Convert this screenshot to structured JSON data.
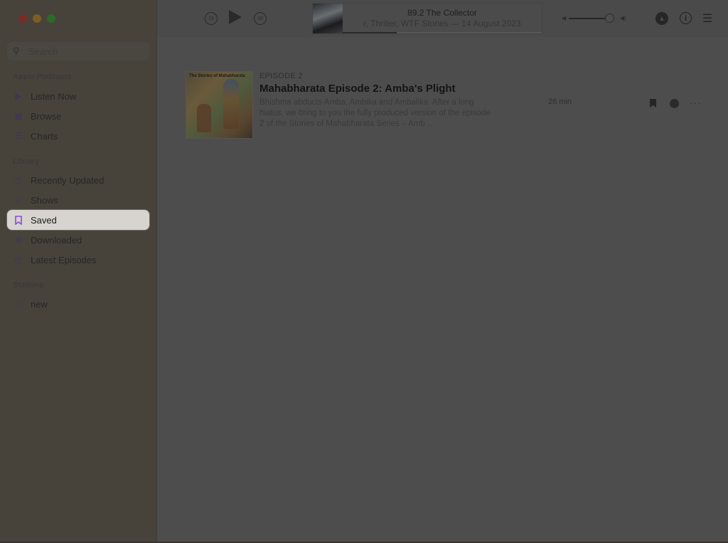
{
  "window": {
    "traffic_lights": [
      "close",
      "minimize",
      "zoom"
    ]
  },
  "sidebar": {
    "search": {
      "placeholder": "Search",
      "value": ""
    },
    "sections": [
      {
        "header": "Apple Podcasts",
        "items": [
          {
            "label": "Listen Now",
            "icon": "play-circle-icon",
            "selected": false
          },
          {
            "label": "Browse",
            "icon": "grid-icon",
            "selected": false
          },
          {
            "label": "Charts",
            "icon": "list-icon",
            "selected": false
          }
        ]
      },
      {
        "header": "Library",
        "items": [
          {
            "label": "Recently Updated",
            "icon": "clock-icon",
            "selected": false
          },
          {
            "label": "Shows",
            "icon": "shows-icon",
            "selected": false
          },
          {
            "label": "Saved",
            "icon": "bookmark-icon",
            "selected": true
          },
          {
            "label": "Downloaded",
            "icon": "download-icon",
            "selected": false
          },
          {
            "label": "Latest Episodes",
            "icon": "latest-icon",
            "selected": false
          }
        ]
      },
      {
        "header": "Stations",
        "items": [
          {
            "label": "new",
            "icon": "station-icon",
            "selected": false
          }
        ]
      }
    ]
  },
  "player": {
    "skip_back_label": "15",
    "skip_forward_label": "30",
    "now_playing_title": "89.2 The Collector",
    "now_playing_subtitle": "r, Thriller, WTF Stories — 14 August 2023",
    "progress_fraction": 0.27,
    "volume_fraction": 0.9,
    "icons": {
      "skip_back": "gobackward-15-icon",
      "play": "play-icon",
      "skip_forward": "goforward-30-icon",
      "airplay": "airplay-icon",
      "info": "info-icon",
      "queue": "queue-list-icon"
    }
  },
  "episodes": [
    {
      "label": "EPISODE 2",
      "title": "Mahabharata Episode 2: Amba's Plight",
      "description": "Bhishma abducts Amba, Ambika and Ambalika. After a long hiatus, we bring to you the fully produced version of the episode 2 of the Stories of Mahabharata Series – Amb…",
      "duration": "26 min",
      "artwork_title": "The Stories of Mahabharata",
      "saved": true
    }
  ],
  "colors": {
    "accent": "#8a4bd8",
    "overlay_bg": "#4c4c4c",
    "sidebar_bg": "#47433b",
    "selected_bg": "#d7d4cf"
  }
}
